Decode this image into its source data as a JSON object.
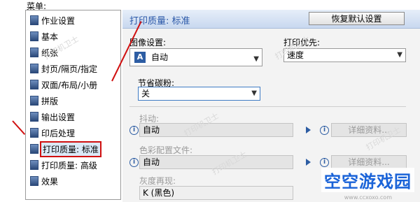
{
  "menu_label": "菜单:",
  "sidebar": {
    "items": [
      {
        "label": "作业设置",
        "icon": "document-settings-icon"
      },
      {
        "label": "基本",
        "icon": "basic-icon"
      },
      {
        "label": "纸张",
        "icon": "paper-icon"
      },
      {
        "label": "封页/隔页/指定",
        "icon": "cover-pages-icon"
      },
      {
        "label": "双面/布局/小册",
        "icon": "duplex-layout-icon"
      },
      {
        "label": "拼版",
        "icon": "imposition-icon"
      },
      {
        "label": "输出设置",
        "icon": "output-settings-icon"
      },
      {
        "label": "印后处理",
        "icon": "finishing-icon"
      },
      {
        "label": "打印质量: 标准",
        "icon": "print-quality-standard-icon",
        "selected": true
      },
      {
        "label": "打印质量: 高级",
        "icon": "print-quality-advanced-icon"
      },
      {
        "label": "效果",
        "icon": "effects-icon"
      }
    ]
  },
  "header": {
    "title": "打印质量: 标准",
    "restore_label": "恢复默认设置"
  },
  "image_settings": {
    "label": "图像设置:",
    "value": "自动"
  },
  "print_priority": {
    "label": "打印优先:",
    "value": "速度"
  },
  "toner_save": {
    "label": "节省碳粉:",
    "value": "关"
  },
  "dither": {
    "label": "抖动:",
    "value": "自动",
    "detail": "详细资料..."
  },
  "color_profile": {
    "label": "色彩配置文件:",
    "value": "自动",
    "detail": "详细资料..."
  },
  "gray_reproduction": {
    "label": "灰度再现:",
    "value": "K (黑色)"
  },
  "watermark_text": "打印机卫士",
  "logo": {
    "text": "空空游戏园",
    "sub": "www.ccxoxo.com"
  }
}
